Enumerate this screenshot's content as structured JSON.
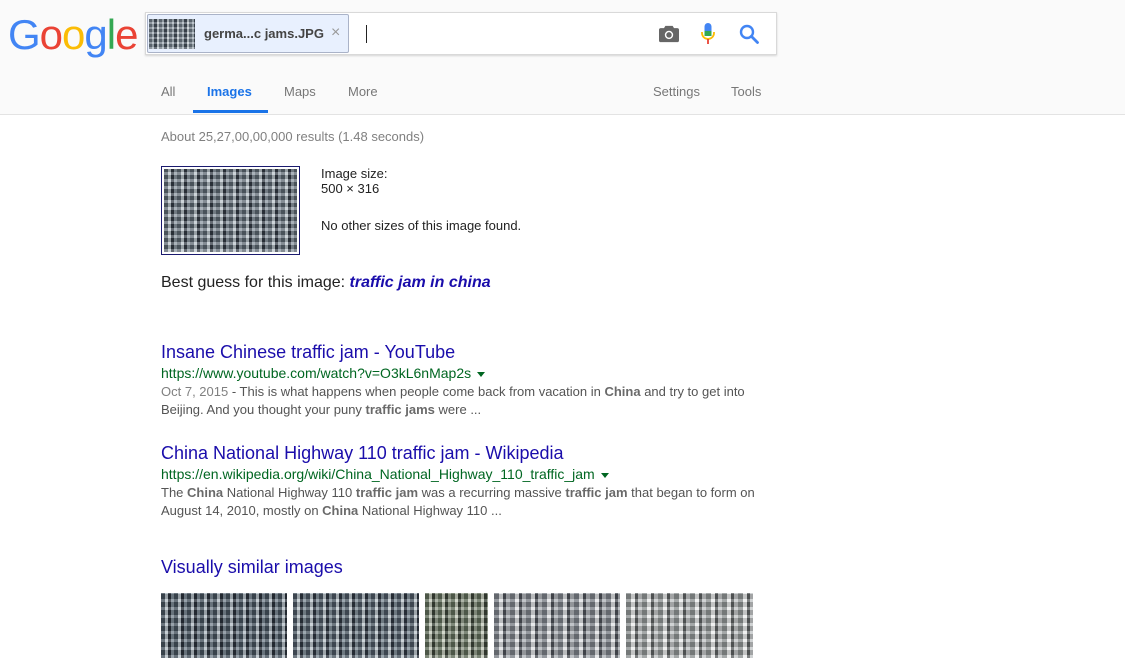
{
  "logo": {
    "letters": [
      "G",
      "o",
      "o",
      "g",
      "l",
      "e"
    ],
    "colors": [
      "#4285f4",
      "#ea4335",
      "#fbbc05",
      "#4285f4",
      "#34a853",
      "#ea4335"
    ]
  },
  "search": {
    "chip_label": "germa...c jams.JPG",
    "chip_close": "×",
    "value": ""
  },
  "nav": {
    "all": "All",
    "images": "Images",
    "maps": "Maps",
    "more": "More",
    "settings": "Settings",
    "tools": "Tools"
  },
  "stats": "About 25,27,00,00,000 results (1.48 seconds)",
  "image_info": {
    "size_label": "Image size:",
    "size_value": "500 × 316",
    "no_other": "No other sizes of this image found."
  },
  "best_guess": {
    "prefix": "Best guess for this image: ",
    "query": "traffic jam in china"
  },
  "results": [
    {
      "title": "Insane Chinese traffic jam - YouTube",
      "url": "https://www.youtube.com/watch?v=O3kL6nMap2s",
      "date": "Oct 7, 2015",
      "snippet_parts": [
        " - This is what happens when people come back from vacation in ",
        "China",
        " and try to get into Beijing. And you thought your puny ",
        "traffic jams",
        " were ..."
      ]
    },
    {
      "title": "China National Highway 110 traffic jam - Wikipedia",
      "url": "https://en.wikipedia.org/wiki/China_National_Highway_110_traffic_jam",
      "date": "",
      "snippet_parts": [
        "The ",
        "China",
        " National Highway 110 ",
        "traffic jam",
        " was a recurring massive ",
        "traffic jam",
        " that began to form on August 14, 2010, mostly on ",
        "China",
        " National Highway 110 ..."
      ]
    }
  ],
  "similar_title": "Visually similar images",
  "colors": {
    "link": "#1a0dab",
    "url": "#006621",
    "accent": "#1a73e8"
  }
}
